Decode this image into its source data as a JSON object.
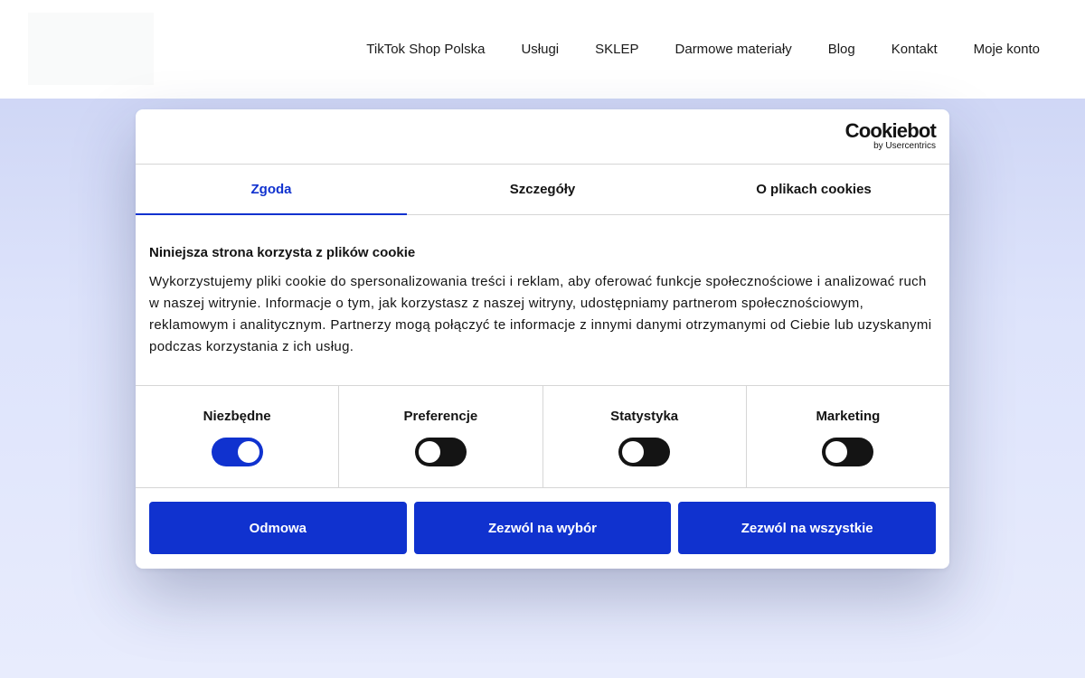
{
  "header": {
    "nav": [
      {
        "label": "TikTok Shop Polska"
      },
      {
        "label": "Usługi"
      },
      {
        "label": "SKLEP"
      },
      {
        "label": "Darmowe materiały"
      },
      {
        "label": "Blog"
      },
      {
        "label": "Kontakt"
      },
      {
        "label": "Moje konto"
      }
    ]
  },
  "dialog": {
    "brand": {
      "name": "Cookiebot",
      "sub": "by Usercentrics"
    },
    "tabs": [
      {
        "label": "Zgoda",
        "active": true
      },
      {
        "label": "Szczegóły",
        "active": false
      },
      {
        "label": "O plikach cookies",
        "active": false
      }
    ],
    "title": "Niniejsza strona korzysta z plików cookie",
    "body": "Wykorzystujemy pliki cookie do spersonalizowania treści i reklam, aby oferować funkcje społecznościowe i analizować ruch w naszej witrynie. Informacje o tym, jak korzystasz z naszej witryny, udostępniamy partnerom społecznościowym, reklamowym i analitycznym. Partnerzy mogą połączyć te informacje z innymi danymi otrzymanymi od Ciebie lub uzyskanymi podczas korzystania z ich usług.",
    "toggles": [
      {
        "label": "Niezbędne",
        "on": true
      },
      {
        "label": "Preferencje",
        "on": false
      },
      {
        "label": "Statystyka",
        "on": false
      },
      {
        "label": "Marketing",
        "on": false
      }
    ],
    "buttons": {
      "deny": "Odmowa",
      "allow_selection": "Zezwól na wybór",
      "allow_all": "Zezwól na wszystkie"
    }
  },
  "colors": {
    "accent": "#1032cf",
    "toggle_off": "#141414"
  }
}
